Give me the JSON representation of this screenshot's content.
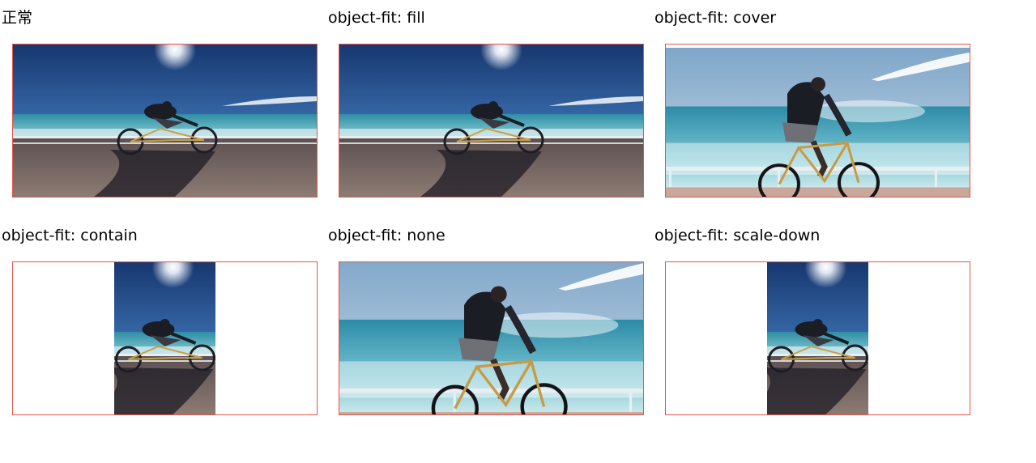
{
  "demo": {
    "items": [
      {
        "label": "正常",
        "mode": "normal"
      },
      {
        "label": "object-fit: fill",
        "mode": "fill"
      },
      {
        "label": "object-fit: cover",
        "mode": "cover"
      },
      {
        "label": "object-fit: contain",
        "mode": "contain"
      },
      {
        "label": "object-fit: none",
        "mode": "none"
      },
      {
        "label": "object-fit: scale-down",
        "mode": "scale-down"
      }
    ],
    "border_color": "#e4554a"
  }
}
